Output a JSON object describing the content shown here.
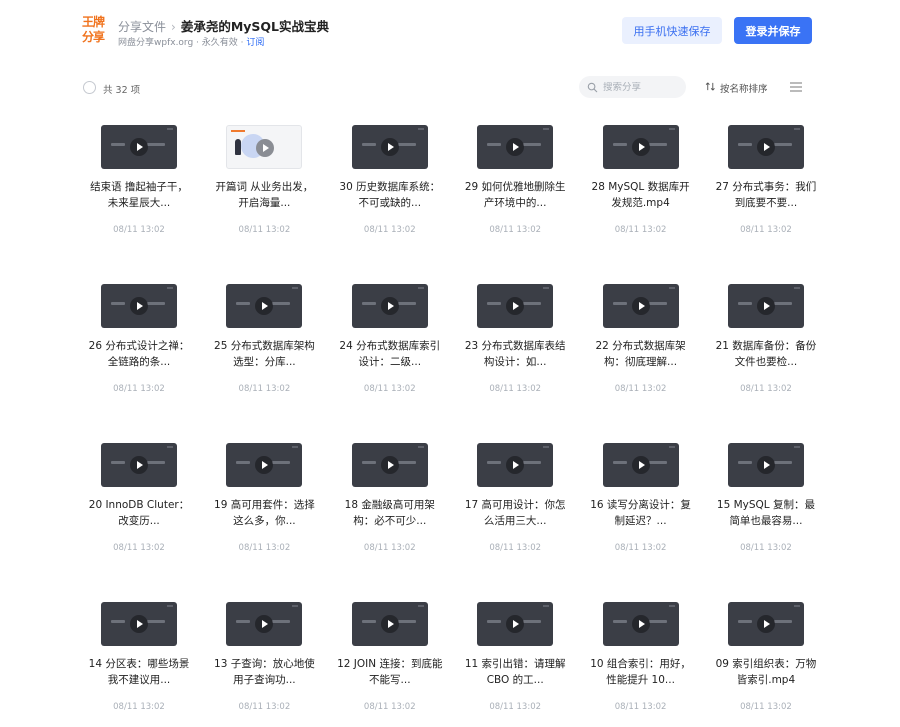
{
  "header": {
    "logo_text": "王牌分享",
    "breadcrumb_root": "分享文件",
    "breadcrumb_sep": "›",
    "title": "姜承尧的MySQL实战宝典",
    "subtitle": "网盘分享wpfx.org · 永久有效 · ",
    "subscribe": "订阅",
    "mobile_button": "用手机快速保存",
    "login_button": "登录并保存"
  },
  "toolbar": {
    "count_label": "共 32 项",
    "search_placeholder": "搜索分享",
    "sort_label": "按名称排序"
  },
  "files": [
    {
      "name": "结束语 撸起袖子干，未来星辰大...",
      "date": "08/11 13:02",
      "thumb": "dark"
    },
    {
      "name": "开篇词 从业务出发，开启海量...",
      "date": "08/11 13:02",
      "thumb": "light"
    },
    {
      "name": "30 历史数据库系统：不可或缺的...",
      "date": "08/11 13:02",
      "thumb": "dark"
    },
    {
      "name": "29 如何优雅地删除生产环境中的...",
      "date": "08/11 13:02",
      "thumb": "dark"
    },
    {
      "name": "28 MySQL 数据库开发规范.mp4",
      "date": "08/11 13:02",
      "thumb": "dark"
    },
    {
      "name": "27 分布式事务：我们到底要不要...",
      "date": "08/11 13:02",
      "thumb": "dark"
    },
    {
      "name": "26 分布式设计之禅：全链路的条...",
      "date": "08/11 13:02",
      "thumb": "dark"
    },
    {
      "name": "25 分布式数据库架构选型：分库...",
      "date": "08/11 13:02",
      "thumb": "dark"
    },
    {
      "name": "24 分布式数据库索引设计：二级...",
      "date": "08/11 13:02",
      "thumb": "dark"
    },
    {
      "name": "23 分布式数据库表结构设计：如...",
      "date": "08/11 13:02",
      "thumb": "dark"
    },
    {
      "name": "22 分布式数据库架构：彻底理解...",
      "date": "08/11 13:02",
      "thumb": "dark"
    },
    {
      "name": "21 数据库备份：备份文件也要检...",
      "date": "08/11 13:02",
      "thumb": "dark"
    },
    {
      "name": "20 InnoDB Cluter：改变历...",
      "date": "08/11 13:02",
      "thumb": "dark"
    },
    {
      "name": "19 高可用套件：选择这么多，你...",
      "date": "08/11 13:02",
      "thumb": "dark"
    },
    {
      "name": "18 金融级高可用架构：必不可少...",
      "date": "08/11 13:02",
      "thumb": "dark"
    },
    {
      "name": "17 高可用设计：你怎么活用三大...",
      "date": "08/11 13:02",
      "thumb": "dark"
    },
    {
      "name": "16 读写分离设计：复制延迟？...",
      "date": "08/11 13:02",
      "thumb": "dark"
    },
    {
      "name": "15 MySQL 复制：最简单也最容易...",
      "date": "08/11 13:02",
      "thumb": "dark"
    },
    {
      "name": "14 分区表：哪些场景我不建议用...",
      "date": "08/11 13:02",
      "thumb": "dark"
    },
    {
      "name": "13 子查询：放心地使用子查询功...",
      "date": "08/11 13:02",
      "thumb": "dark"
    },
    {
      "name": "12 JOIN 连接：到底能不能写...",
      "date": "08/11 13:02",
      "thumb": "dark"
    },
    {
      "name": "11 索引出错：请理解 CBO 的工...",
      "date": "08/11 13:02",
      "thumb": "dark"
    },
    {
      "name": "10 组合索引：用好，性能提升 10...",
      "date": "08/11 13:02",
      "thumb": "dark"
    },
    {
      "name": "09 索引组织表：万物皆索引.mp4",
      "date": "08/11 13:02",
      "thumb": "dark"
    }
  ],
  "colors": {
    "accent": "#3a73f5",
    "logo": "#f0731e",
    "thumb_dark": "#3b3e46"
  }
}
